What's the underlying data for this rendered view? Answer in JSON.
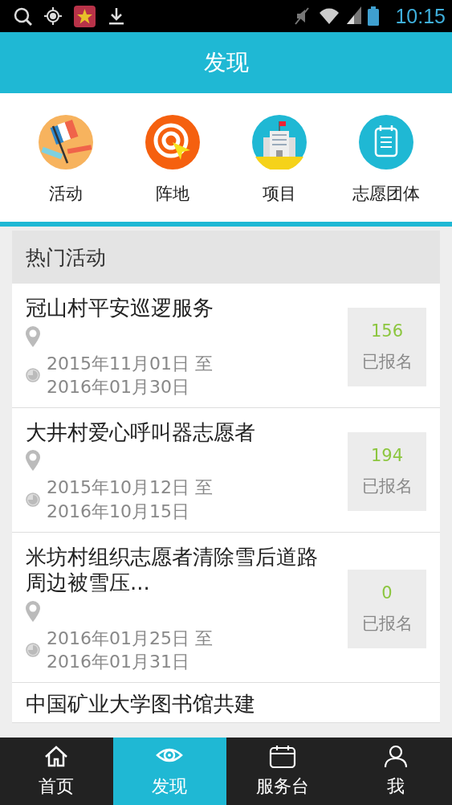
{
  "status_bar": {
    "time": "10:15"
  },
  "title": "发现",
  "categories": [
    {
      "label": "活动",
      "kind": "flag"
    },
    {
      "label": "阵地",
      "kind": "target"
    },
    {
      "label": "项目",
      "kind": "building"
    },
    {
      "label": "志愿团体",
      "kind": "notepad"
    }
  ],
  "section_title": "热门活动",
  "activities": [
    {
      "title": "冠山村平安巡逻服务",
      "date_start": "2015年11月01日 至",
      "date_end": "2016年01月30日",
      "count": "156",
      "count_label": "已报名"
    },
    {
      "title": "大井村爱心呼叫器志愿者",
      "date_start": "2015年10月12日 至",
      "date_end": "2016年10月15日",
      "count": "194",
      "count_label": "已报名"
    },
    {
      "title": "米坊村组织志愿者清除雪后道路周边被雪压...",
      "date_start": "2016年01月25日 至",
      "date_end": "2016年01月31日",
      "count": "0",
      "count_label": "已报名"
    },
    {
      "title": "中国矿业大学图书馆共建"
    }
  ],
  "tabs": [
    {
      "label": "首页",
      "kind": "home",
      "selected": false
    },
    {
      "label": "发现",
      "kind": "eye",
      "selected": true
    },
    {
      "label": "服务台",
      "kind": "calendar",
      "selected": false
    },
    {
      "label": "我",
      "kind": "person",
      "selected": false
    }
  ]
}
